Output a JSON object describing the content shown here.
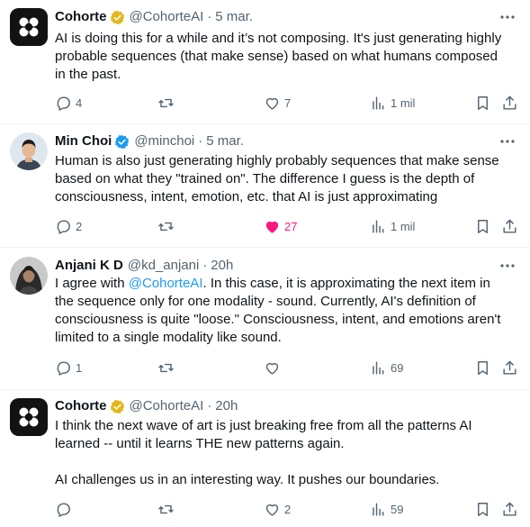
{
  "tweets": [
    {
      "name": "Cohorte",
      "handle": "@CohorteAI",
      "time": "5 mar.",
      "verified": "gold",
      "avatar": "cohorte-logo",
      "text_lines": [
        "AI is doing this for a while and it’s not composing. It's just generating highly",
        "probable sequences (that make sense) based on what humans composed",
        "in the past."
      ],
      "replies": "4",
      "reposts": "",
      "likes": "7",
      "views": "1 mil"
    },
    {
      "name": "Min Choi",
      "handle": "@minchoi",
      "time": "5 mar.",
      "verified": "blue",
      "avatar": "person-photo",
      "text_lines": [
        "Human is also just generating highly probably sequences that make sense",
        "based on what they \"trained on\".  The difference I guess is the depth of",
        "consciousness, intent, emotion, etc. that AI is just approximating"
      ],
      "replies": "2",
      "reposts": "",
      "likes": "27",
      "views": "1 mil"
    },
    {
      "name": "Anjani K D",
      "handle": "@kd_anjani",
      "time": "20h",
      "verified": "none",
      "avatar": "person-photo",
      "text_pre": "I agree with ",
      "mention": "@CohorteAI",
      "text_post_first": ". In this case, it is approximating the next item in",
      "text_lines_rest": [
        "the sequence only for one modality - sound. Currently, AI's definition of",
        "consciousness is quite \"loose.\" Consciousness, intent, and emotions aren't",
        "limited to a single modality like sound."
      ],
      "replies": "1",
      "reposts": "",
      "likes": "",
      "views": "69"
    },
    {
      "name": "Cohorte",
      "handle": "@CohorteAI",
      "time": "20h",
      "verified": "gold",
      "avatar": "cohorte-logo",
      "text_lines": [
        "I think the next wave of art is just breaking free from all the patterns AI",
        "learned -- until it learns THE new patterns again."
      ],
      "text_lines_2": [
        "AI challenges us in an interesting way. It pushes our boundaries."
      ],
      "replies": "",
      "reposts": "",
      "likes": "2",
      "views": "59"
    }
  ],
  "colors": {
    "accent": "#1d9bf0",
    "like": "#f91880",
    "gold_badge": "#e2b719",
    "secondary_text": "#536471"
  }
}
